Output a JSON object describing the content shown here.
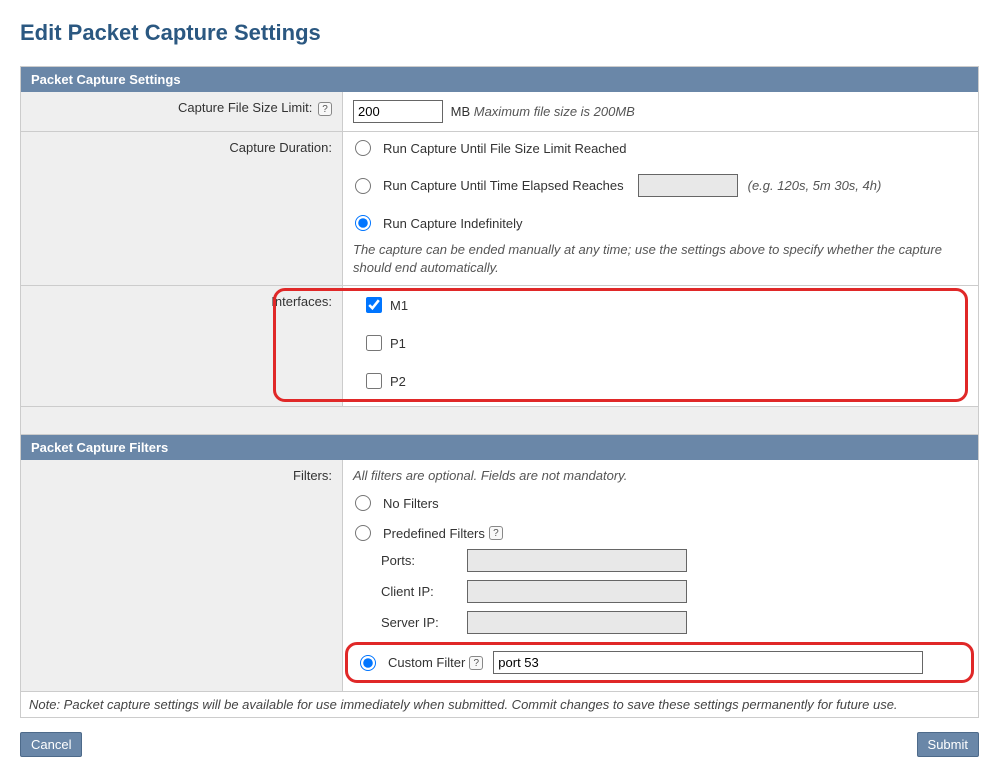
{
  "page": {
    "title": "Edit Packet Capture Settings"
  },
  "settings": {
    "header": "Packet Capture Settings",
    "fileSize": {
      "label": "Capture File Size Limit:",
      "value": "200",
      "unit": "MB",
      "hint": "Maximum file size is 200MB"
    },
    "duration": {
      "label": "Capture Duration:",
      "options": {
        "untilSize": "Run Capture Until File Size Limit Reached",
        "untilTime": "Run Capture Until Time Elapsed Reaches",
        "indef": "Run Capture Indefinitely"
      },
      "timeValue": "",
      "timeHint": "(e.g. 120s, 5m 30s, 4h)",
      "note": "The capture can be ended manually at any time; use the settings above to specify whether the capture should end automatically."
    },
    "interfaces": {
      "label": "Interfaces:",
      "items": [
        "M1",
        "P1",
        "P2"
      ]
    }
  },
  "filters": {
    "header": "Packet Capture Filters",
    "label": "Filters:",
    "intro": "All filters are optional. Fields are not mandatory.",
    "options": {
      "none": "No Filters",
      "predefined": "Predefined Filters",
      "custom": "Custom Filter"
    },
    "predefinedFields": {
      "ports": {
        "label": "Ports:",
        "value": ""
      },
      "clientIp": {
        "label": "Client IP:",
        "value": ""
      },
      "serverIp": {
        "label": "Server IP:",
        "value": ""
      }
    },
    "customValue": "port 53"
  },
  "footer": {
    "note": "Note: Packet capture settings will be available for use immediately when submitted. Commit changes to save these settings permanently for future use.",
    "cancel": "Cancel",
    "submit": "Submit"
  }
}
